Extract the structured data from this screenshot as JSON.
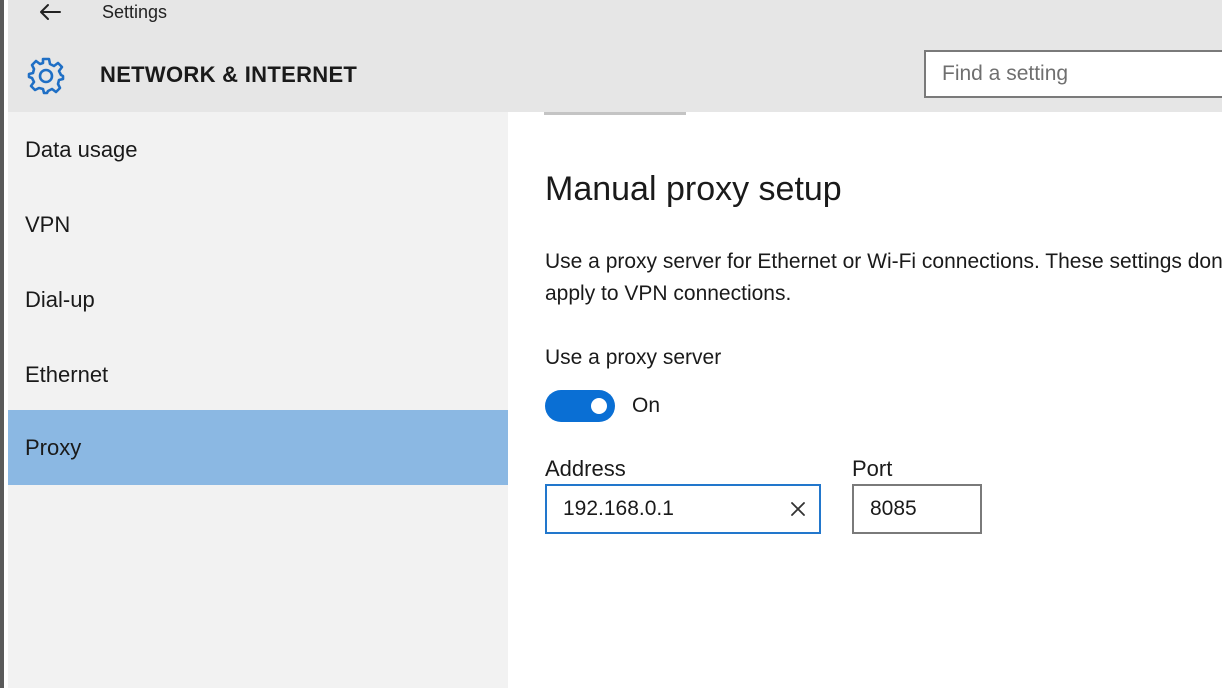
{
  "window": {
    "title": "Settings"
  },
  "header": {
    "section_title": "NETWORK & INTERNET",
    "search_placeholder": "Find a setting",
    "icons": {
      "back": "back-arrow-icon",
      "settings": "gear-icon"
    }
  },
  "sidebar": {
    "items": [
      {
        "label": "Data usage",
        "selected": false
      },
      {
        "label": "VPN",
        "selected": false
      },
      {
        "label": "Dial-up",
        "selected": false
      },
      {
        "label": "Ethernet",
        "selected": false
      },
      {
        "label": "Proxy",
        "selected": true
      }
    ]
  },
  "content": {
    "heading": "Manual proxy setup",
    "description": "Use a proxy server for Ethernet or Wi-Fi connections. These settings don't apply to VPN connections.",
    "use_proxy_label": "Use a proxy server",
    "toggle": {
      "state_label": "On",
      "on": true
    },
    "address": {
      "label": "Address",
      "value": "192.168.0.1"
    },
    "port": {
      "label": "Port",
      "value": "8085"
    }
  },
  "colors": {
    "header_bg": "#e6e6e6",
    "sidebar_bg": "#f2f2f2",
    "selected_bg": "#8bb8e3",
    "accent": "#0a6fd4",
    "focus_border": "#2277cc"
  }
}
